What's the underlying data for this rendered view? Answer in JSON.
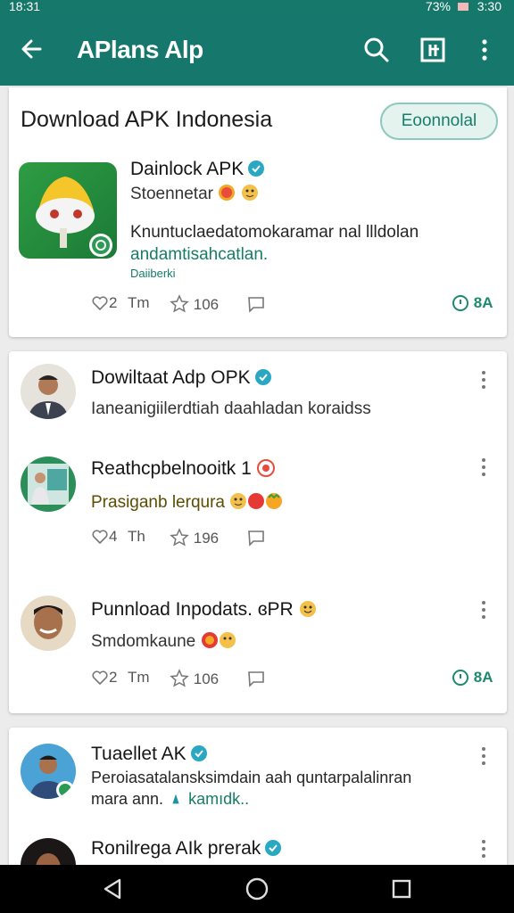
{
  "status_bar": {
    "time_left": "18:31",
    "battery": "73%",
    "time_right": "3:30"
  },
  "app_bar": {
    "title": "APlans Alp",
    "actions": [
      "search-icon",
      "grid-icon",
      "more-vert-icon"
    ]
  },
  "featured": {
    "heading": "Download APK Indonesia",
    "download_button": "Eoonnolal",
    "app_name": "Dainlock APK",
    "subtitle": "Stoennetar",
    "description_line1": "Knuntuclaedatomokaramar nal llldolan",
    "description_line2": "andamtisahcatlan.",
    "description_line3": "Daiiberki",
    "stats": {
      "likes": "2",
      "time": "Tm",
      "stars": "106",
      "status": "8A"
    }
  },
  "posts": [
    {
      "title": "Dowiltaat Adp OPK",
      "subtitle": "Ianeanigiilerdtiah daahladan koraidss"
    },
    {
      "title": "Reathcpbelnooitk 1",
      "subtitle": "Prasiganb lerqura",
      "stats": {
        "likes": "4",
        "time": "Th",
        "stars": "196"
      }
    },
    {
      "title": "Punnload Inpodats. ɞPR",
      "subtitle": "Smdomkaune",
      "stats": {
        "likes": "2",
        "time": "Tm",
        "stars": "106",
        "status": "8A"
      }
    }
  ],
  "posts2": [
    {
      "title": "Tuaellet AK",
      "line1": "Peroiasatalansksimdain aah quntarpalalinran",
      "line2": "mara ann.",
      "link": "kamıdk.."
    },
    {
      "title": "Ronilrega AIk prerak"
    }
  ],
  "colors": {
    "primary": "#16786c",
    "accent": "#1d8a6e",
    "verify": "#2aa7c2"
  }
}
